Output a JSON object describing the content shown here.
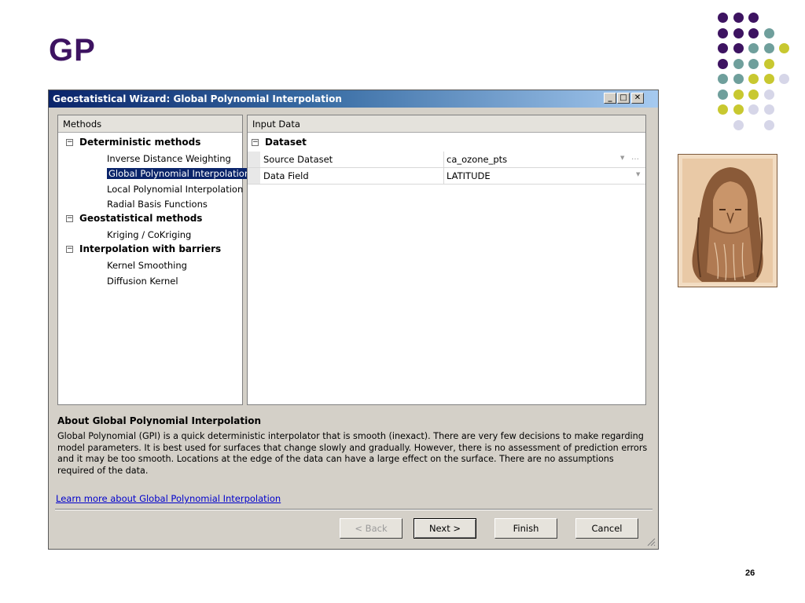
{
  "slide": {
    "title": "GP",
    "page_number": "26"
  },
  "colors": {
    "purple": "#3d1361",
    "teal": "#6f9f9c",
    "yellow": "#c8c830",
    "lavender": "#d6d6e8",
    "title_bar": "#0a246a"
  },
  "dialog": {
    "title": "Geostatistical Wizard: Global Polynomial Interpolation",
    "window_buttons": {
      "minimize": "_",
      "maximize": "□",
      "close": "✕"
    },
    "methods_header": "Methods",
    "input_header": "Input Data",
    "methods": {
      "deterministic": {
        "label": "Deterministic methods",
        "items": [
          "Inverse Distance Weighting",
          "Global Polynomial Interpolation",
          "Local Polynomial Interpolation",
          "Radial Basis Functions"
        ]
      },
      "geostatistical": {
        "label": "Geostatistical methods",
        "items": [
          "Kriging / CoKriging"
        ]
      },
      "barriers": {
        "label": "Interpolation with barriers",
        "items": [
          "Kernel Smoothing",
          "Diffusion Kernel"
        ]
      },
      "selected": "Global Polynomial Interpolation"
    },
    "dataset": {
      "label": "Dataset",
      "rows": [
        {
          "key": "Source Dataset",
          "value": "ca_ozone_pts"
        },
        {
          "key": "Data Field",
          "value": "LATITUDE"
        }
      ]
    },
    "about": {
      "title": "About Global Polynomial Interpolation",
      "text": "Global Polynomial (GPI) is a quick deterministic interpolator that is smooth (inexact). There are very few decisions to make regarding model parameters. It is best used for surfaces that change slowly and gradually. However, there is no assessment of prediction errors and it may be too smooth. Locations at the edge of the data can have a large effect on the surface. There are no assumptions required of the data.",
      "link": "Learn more about Global Polynomial Interpolation"
    },
    "buttons": {
      "back": "< Back",
      "next": "Next >",
      "finish": "Finish",
      "cancel": "Cancel"
    }
  }
}
